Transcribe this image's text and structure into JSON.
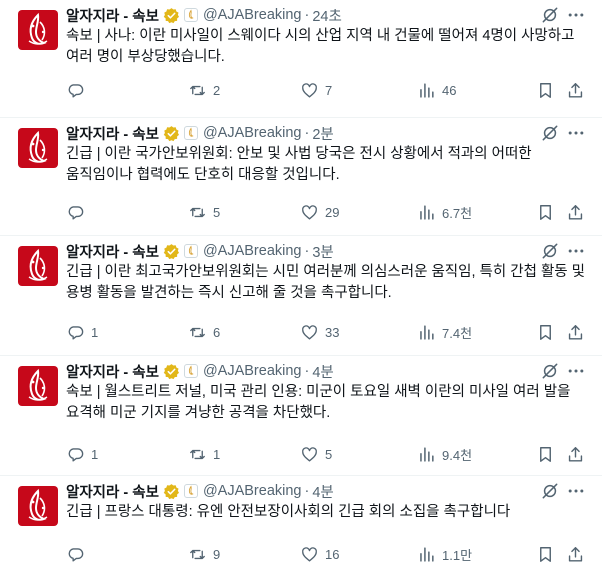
{
  "tweets": [
    {
      "author": "알자지라 - 속보",
      "handle": "@AJABreaking",
      "time": "24초",
      "text": "속보 | 사나: 이란 미사일이 스웨이다 시의 산업 지역 내 건물에 떨어져 4명이 사망하고 여러 명이 부상당했습니다.",
      "replies": "",
      "reposts": "2",
      "likes": "7",
      "views": "46"
    },
    {
      "author": "알자지라 - 속보",
      "handle": "@AJABreaking",
      "time": "2분",
      "text": "긴급 | 이란 국가안보위원회: 안보 및 사법 당국은 전시 상황에서 적과의 어떠한 움직임이나 협력에도 단호히 대응할 것입니다.",
      "replies": "",
      "reposts": "5",
      "likes": "29",
      "views": "6.7천"
    },
    {
      "author": "알자지라 - 속보",
      "handle": "@AJABreaking",
      "time": "3분",
      "text": "긴급 | 이란 최고국가안보위원회는 시민 여러분께 의심스러운 움직임, 특히 간첩 활동 및 용병 활동을 발견하는 즉시 신고해 줄 것을 촉구합니다.",
      "replies": "1",
      "reposts": "6",
      "likes": "33",
      "views": "7.4천"
    },
    {
      "author": "알자지라 - 속보",
      "handle": "@AJABreaking",
      "time": "4분",
      "text": "속보 | 월스트리트 저널, 미국 관리 인용: 미군이 토요일 새벽 이란의 미사일 여러 발을 요격해 미군 기지를 겨냥한 공격을 차단했다.",
      "replies": "1",
      "reposts": "1",
      "likes": "5",
      "views": "9.4천"
    },
    {
      "author": "알자지라 - 속보",
      "handle": "@AJABreaking",
      "time": "4분",
      "text": "긴급 | 프랑스 대통령: 유엔 안전보장이사회의 긴급 회의 소집을 촉구합니다",
      "replies": "",
      "reposts": "9",
      "likes": "16",
      "views": "1.1만"
    }
  ],
  "separator": "·",
  "colors": {
    "avatar_bg": "#c6081a",
    "verified": "#e2b719",
    "text_secondary": "#536471"
  },
  "icons": [
    "aljazeera-logo",
    "verified-badge-icon",
    "affiliate-badge-icon",
    "grok-icon",
    "more-icon",
    "reply-icon",
    "repost-icon",
    "like-icon",
    "views-icon",
    "bookmark-icon",
    "share-icon"
  ]
}
